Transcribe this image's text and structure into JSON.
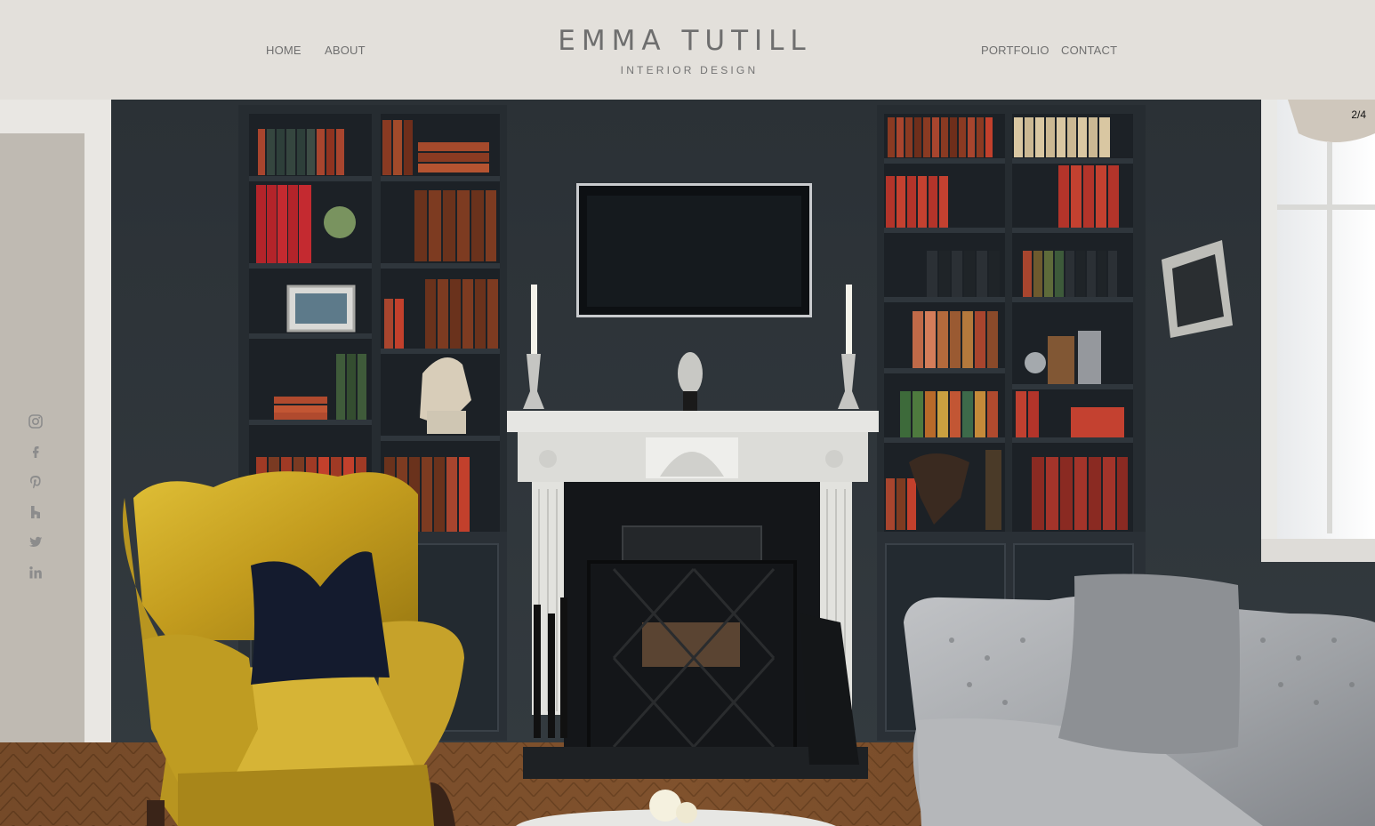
{
  "nav": {
    "home": "HOME",
    "about": "ABOUT",
    "portfolio": "PORTFOLIO",
    "contact": "CONTACT"
  },
  "brand": {
    "name": "EMMA TUTILL",
    "subtitle": "INTERIOR DESIGN"
  },
  "slideshow": {
    "counter": "2/4"
  },
  "social": [
    "instagram-icon",
    "facebook-icon",
    "pinterest-icon",
    "houzz-icon",
    "twitter-icon",
    "linkedin-icon"
  ],
  "colors": {
    "header_bg": "#e3e0db",
    "nav_text": "#6f6f6f",
    "wall": "#2d3338",
    "chair": "#c9a623",
    "sofa": "#a6a8ab"
  }
}
